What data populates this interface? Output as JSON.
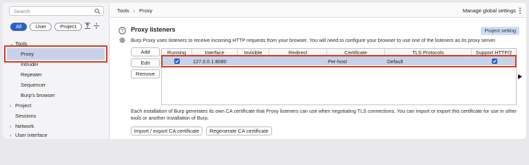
{
  "sidebar": {
    "search_placeholder": "Search",
    "filters": [
      "All",
      "User",
      "Project"
    ],
    "tree": {
      "tools": "Tools",
      "proxy": "Proxy",
      "intruder": "Intruder",
      "repeater": "Repeater",
      "sequencer": "Sequencer",
      "burps_browser": "Burp's browser",
      "project": "Project",
      "sessions": "Sessions",
      "network": "Network",
      "user_interface": "User interface"
    }
  },
  "topbar": {
    "breadcrumb": [
      "Tools",
      "Proxy"
    ],
    "manage_label": "Manage global settings"
  },
  "proxy_listeners": {
    "title": "Proxy listeners",
    "badge": "Project setting",
    "description": "Burp Proxy uses listeners to receive incoming HTTP requests from your browser. You will need to configure your browser to use one of the listeners as its proxy server.",
    "buttons": {
      "add": "Add",
      "edit": "Edit",
      "remove": "Remove"
    },
    "columns": [
      "Running",
      "Interface",
      "Invisible",
      "Redirect",
      "Certificate",
      "TLS Protocols",
      "Support HTTP/2"
    ],
    "rows": [
      {
        "running": true,
        "interface": "127.0.0.1:8080",
        "invisible": "",
        "redirect": "",
        "certificate": "Per-host",
        "tls_protocols": "Default",
        "support_http2": true
      }
    ]
  },
  "ca_certificate": {
    "text": "Each installation of Burp generates its own CA certificate that Proxy listeners can use when negotiating TLS connections. You can import or export this certificate for use in other tools or another installation of Burp.",
    "import_export_label": "Import / export CA certificate",
    "regenerate_label": "Regenerate CA certificate"
  },
  "colors": {
    "accent": "#2d5fc9",
    "highlight_border": "#d9381e",
    "selection": "#c7d2ea"
  }
}
